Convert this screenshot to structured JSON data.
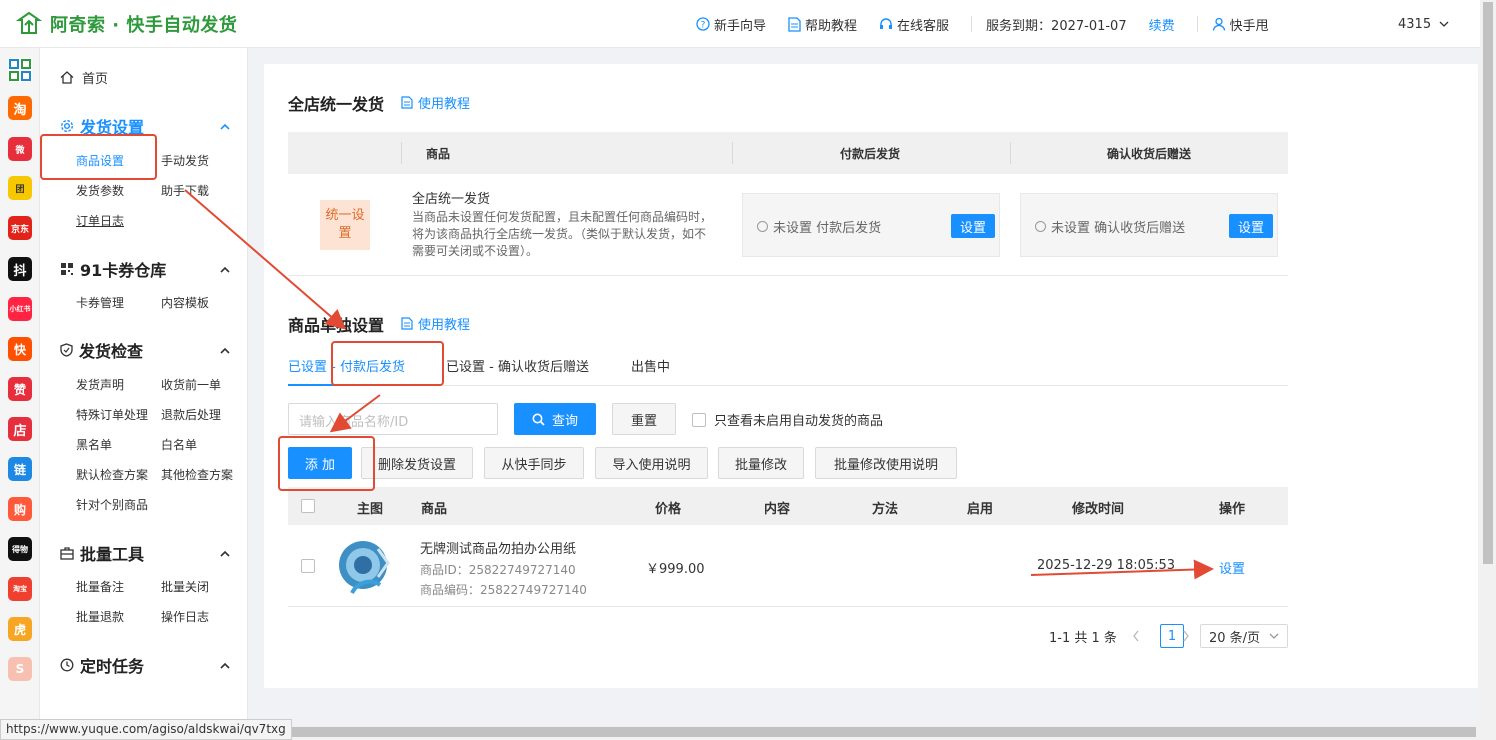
{
  "header": {
    "brand": "阿奇索 · 快手自动发货",
    "nav": {
      "guide": "新手向导",
      "help": "帮助教程",
      "service": "在线客服",
      "expire_label": "服务到期：2027-01-07",
      "renew": "续费",
      "user": "快手甩",
      "user_id": "4315"
    }
  },
  "apps": [
    "淘",
    "微",
    "团",
    "京东",
    "抖",
    "小红书",
    "快",
    "赞",
    "店",
    "链",
    "购",
    "得物",
    "淘宝",
    "虎",
    "S"
  ],
  "sidebar": {
    "home": "首页",
    "groups": [
      {
        "title": "发货设置",
        "items": [
          "商品设置",
          "手动发货",
          "发货参数",
          "助手下载",
          "订单日志"
        ]
      },
      {
        "title": "91卡券仓库",
        "items": [
          "卡券管理",
          "内容模板"
        ]
      },
      {
        "title": "发货检查",
        "items": [
          "发货声明",
          "收货前一单",
          "特殊订单处理",
          "退款后处理",
          "黑名单",
          "白名单",
          "默认检查方案",
          "其他检查方案",
          "针对个别商品"
        ]
      },
      {
        "title": "批量工具",
        "items": [
          "批量备注",
          "批量关闭",
          "批量退款",
          "操作日志"
        ]
      },
      {
        "title": "定时任务",
        "items": []
      }
    ]
  },
  "global_section": {
    "title": "全店统一发货",
    "tutorial": "使用教程",
    "columns": [
      "商品",
      "付款后发货",
      "确认收货后赠送"
    ],
    "row": {
      "tag": "统一设置",
      "name": "全店统一发货",
      "desc": "当商品未设置任何发货配置，且未配置任何商品编码时，将为该商品执行全店统一发货。（类似于默认发货，如不需要可关闭或不设置）。",
      "pay_radio": "未设置 付款后发货",
      "confirm_radio": "未设置 确认收货后赠送",
      "set_button": "设置"
    }
  },
  "item_section": {
    "title": "商品单独设置",
    "tutorial": "使用教程",
    "tabs": [
      "已设置 - 付款后发货",
      "已设置 - 确认收货后赠送",
      "出售中"
    ],
    "search_placeholder": "请输入商品名称/ID",
    "query": "查询",
    "reset": "重置",
    "only_unenabled": "只查看未启用自动发货的商品",
    "actions": [
      "添 加",
      "删除发货设置",
      "从快手同步",
      "导入使用说明",
      "批量修改",
      "批量修改使用说明"
    ],
    "columns": [
      "主图",
      "商品",
      "价格",
      "内容",
      "方法",
      "启用",
      "修改时间",
      "操作"
    ],
    "rows": [
      {
        "name": "无牌测试商品勿拍办公用纸",
        "id_label": "商品ID：25822749727140",
        "code_label": "商品编码：25822749727140",
        "price": "￥999.00",
        "modified": "2025-12-29 18:05:53",
        "op": "设置"
      }
    ],
    "pagination": {
      "summary": "1-1 共 1 条",
      "current": "1",
      "page_size": "20 条/页"
    }
  },
  "status_url": "https://www.yuque.com/agiso/aldskwai/qv7txg"
}
